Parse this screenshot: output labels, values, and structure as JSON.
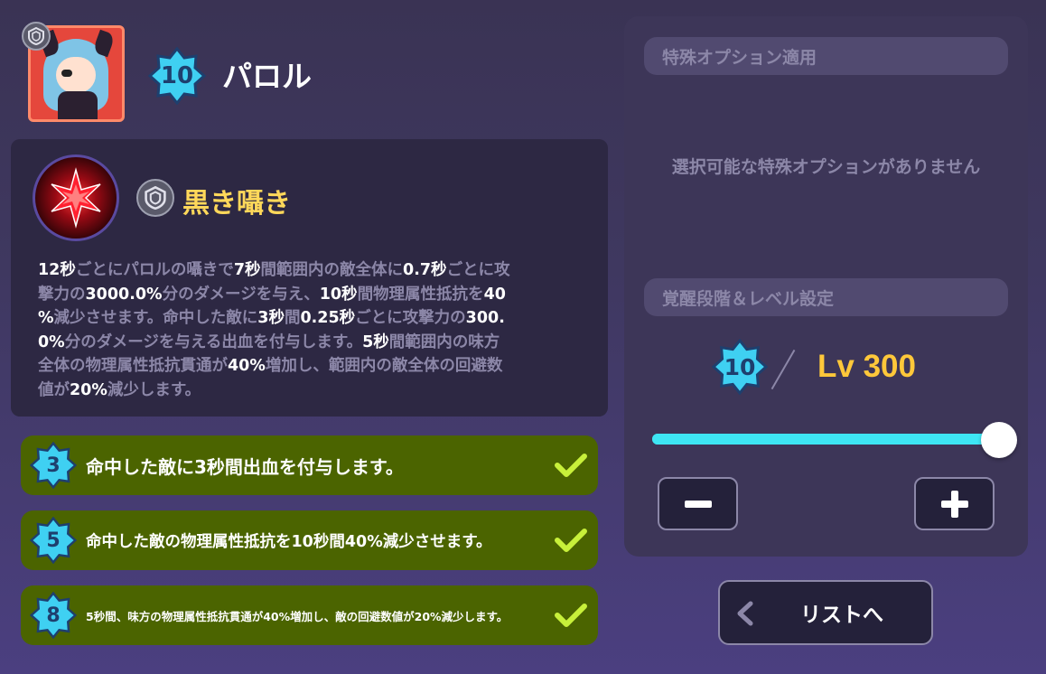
{
  "character": {
    "icon": "character-portrait",
    "grade_icon": "shield-grade-icon",
    "awaken_level": "10",
    "name": "パロル"
  },
  "skill": {
    "icon": "red-star-skill-icon",
    "grade_icon": "shield-grade-icon",
    "name": "黒き囁き",
    "description": [
      [
        {
          "t": "12秒",
          "h": true
        },
        {
          "t": "ごとにパロルの囁きで",
          "h": false
        },
        {
          "t": "7秒",
          "h": true
        },
        {
          "t": "間範囲内の敵全体に",
          "h": false
        },
        {
          "t": "0.7秒",
          "h": true
        },
        {
          "t": "ごとに攻",
          "h": false
        }
      ],
      [
        {
          "t": "撃力の",
          "h": false
        },
        {
          "t": "3000.0%",
          "h": true
        },
        {
          "t": "分のダメージを与え、",
          "h": false
        },
        {
          "t": "10秒",
          "h": true
        },
        {
          "t": "間物理属性抵抗を",
          "h": false
        },
        {
          "t": "40",
          "h": true
        }
      ],
      [
        {
          "t": "%",
          "h": true
        },
        {
          "t": "減少させます。命中した敵に",
          "h": false
        },
        {
          "t": "3秒",
          "h": true
        },
        {
          "t": "間",
          "h": false
        },
        {
          "t": "0.25秒",
          "h": true
        },
        {
          "t": "ごとに攻撃力の",
          "h": false
        },
        {
          "t": "300.",
          "h": true
        }
      ],
      [
        {
          "t": "0%",
          "h": true
        },
        {
          "t": "分のダメージを与える出血を付与します。",
          "h": false
        },
        {
          "t": "5秒",
          "h": true
        },
        {
          "t": "間範囲内の味方",
          "h": false
        }
      ],
      [
        {
          "t": "全体の物理属性抵抗貫通が",
          "h": false
        },
        {
          "t": "40%",
          "h": true
        },
        {
          "t": "増加し、範囲内の敵全体の回避数",
          "h": false
        }
      ],
      [
        {
          "t": "値が",
          "h": false
        },
        {
          "t": "20%",
          "h": true
        },
        {
          "t": "減少します。",
          "h": false
        }
      ]
    ]
  },
  "options": [
    {
      "level": "3",
      "text": "命中した敵に3秒間出血を付与します。",
      "checked": true,
      "icon": "check-icon"
    },
    {
      "level": "5",
      "text": "命中した敵の物理属性抵抗を10秒間40%減少させます。",
      "checked": true,
      "icon": "check-icon"
    },
    {
      "level": "8",
      "text": "5秒間、味方の物理属性抵抗貫通が40%増加し、敵の回避数値が20%減少します。",
      "checked": true,
      "icon": "check-icon"
    }
  ],
  "special_option": {
    "header": "特殊オプション適用",
    "empty_message": "選択可能な特殊オプションがありません"
  },
  "level_setting": {
    "header": "覚醒段階＆レベル設定",
    "awaken_level": "10",
    "level_text": "Lv 300",
    "slider_fraction": 1.0,
    "minus_label": "−",
    "plus_label": "+"
  },
  "list_button": {
    "label": "リストへ",
    "icon": "chevron-left-icon"
  },
  "colors": {
    "accent_cyan": "#3ee6f4",
    "skill_name": "#ffd85a",
    "level_text": "#ffc83a",
    "option_bg": "#4b6400",
    "check": "#c8f03a"
  }
}
